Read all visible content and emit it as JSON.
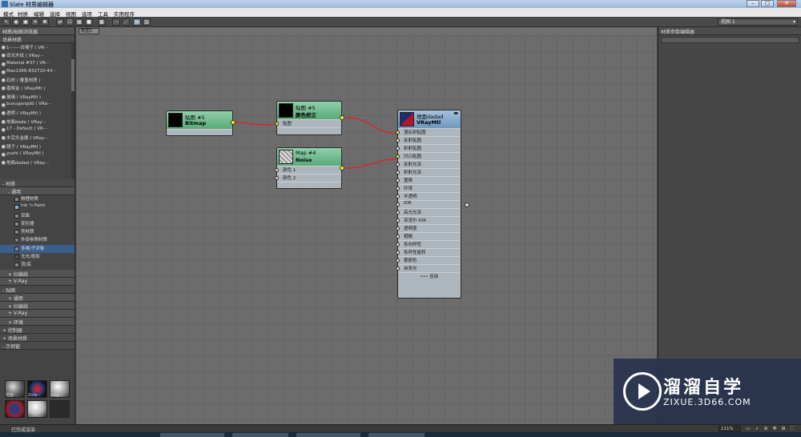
{
  "window": {
    "title": "Slate 材质编辑器",
    "min": "–",
    "max": "□",
    "close": "✕"
  },
  "menu": [
    "模式",
    "材质",
    "编辑",
    "选择",
    "视图",
    "选项",
    "工具",
    "实用程序"
  ],
  "toolbar": {
    "view_select": "视图 1"
  },
  "browser": {
    "title": "材质/贴图浏览器",
    "scene_section": "场景材质",
    "materials": [
      "1-------白墙子 ( VR···",
      "亚光木纹 ( VRay···",
      "Material #37 ( VR···",
      "Max1366-832710-44···",
      "石材 ( 覆盖材质 )",
      "香槟金 ( VRayMtl )",
      "玻璃 ( VRayMtl )",
      "buxugangdd ( VRa···",
      "透明 ( VRayMtl )",
      "地面dada ( VRay···",
      "17 - Default ( VR···",
      "木完头金属 ( VRay···",
      "镜子 ( VRayMtl )",
      "yushi ( VRayMtl )",
      "地面dadad ( VRay···"
    ],
    "materials_section": "- 材质",
    "general_section": "- 通用",
    "general_items": [
      "物理材质",
      "Ink 'n Paint",
      "双面",
      "变形器",
      "壳材质",
      "外部参照材质",
      "多维/子对象",
      "无光/投影",
      "顶/底"
    ],
    "scanline_section": "+ 扫描线",
    "vray_section": "+ V-Ray",
    "maps_section": "- 贴图",
    "maps_general": "+ 通用",
    "maps_scanline": "+ 扫描线",
    "maps_vray": "+ V-Ray",
    "maps_env": "+ 环境",
    "controllers_section": "+ 控制器",
    "scene_mats_section": "+ 场景材质",
    "sample_section": "- 示例窗",
    "samples": [
      "地面···",
      "Zola···",
      "baig···",
      "",
      "",
      ""
    ]
  },
  "view": {
    "tab": "视图1",
    "nodes": {
      "bitmap": {
        "t1": "贴图 #5",
        "t2": "Bitmap"
      },
      "color_correct": {
        "t1": "贴图 #5",
        "t2": "颜色校正",
        "slot": "贴图"
      },
      "noise": {
        "t1": "Map #4",
        "t2": "Noise",
        "slots": [
          "颜色 1",
          "颜色 2"
        ]
      },
      "vraymtl": {
        "t1": "地面dadad",
        "t2": "VRayMtl",
        "slots": [
          "漫反射贴图",
          "反射贴图",
          "折射贴图",
          "凹凸贴图",
          "反射光泽",
          "折射光泽",
          "置换",
          "环境",
          "半透明",
          "IOR",
          "高光光泽",
          "菲涅尔 IOR",
          "透明度",
          "粗糙",
          "各向异性",
          "各异性旋转",
          "雾颜色",
          "自发光"
        ],
        "more": "••• 连接"
      }
    }
  },
  "props": {
    "title": "材质参数编辑器"
  },
  "status": {
    "text": "已完成渲染",
    "zoom": "111%"
  },
  "watermark": {
    "title": "溜溜自学",
    "url": "ZIXUE.3D66.COM"
  },
  "colors": {
    "node_green": "#59ab79",
    "node_blue": "#6f98bf",
    "wire": "#d62a2a",
    "socket_active": "#e8f02a"
  }
}
